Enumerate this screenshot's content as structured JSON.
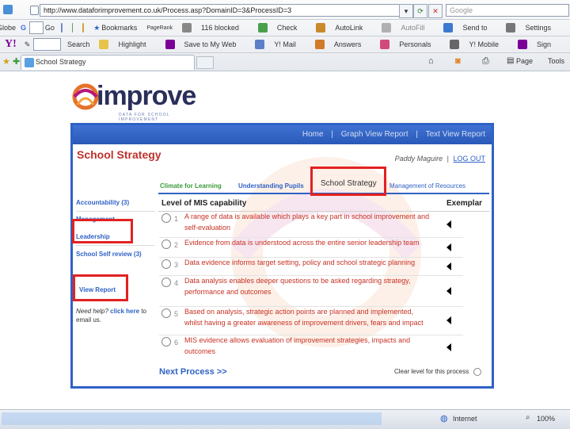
{
  "browser": {
    "address": "http://www.dataforimprovement.co.uk/Process.asp?DomainID=3&ProcessID=3",
    "search_placeholder": "Google",
    "toolbar1": {
      "brand_label": "Globe",
      "go_label": "Go",
      "bookmarks_label": "Bookmarks",
      "pagerank_label": "PageRank",
      "blocked_label": "116 blocked",
      "check_label": "Check",
      "autolink_label": "AutoLink",
      "autofill_label": "AutoFill",
      "send_label": "Send to",
      "settings_label": "Settings"
    },
    "toolbar2": {
      "search_label": "Search",
      "highlight_label": "Highlight",
      "save_label": "Save to My Web",
      "mail_label": "Y! Mail",
      "answers_label": "Answers",
      "personals_label": "Personals",
      "mobile_label": "Y! Mobile",
      "sign_label": "Sign"
    },
    "tab_title": "School Strategy",
    "page_label": "Page",
    "tools_label": "Tools",
    "status": {
      "zone_label": "Internet",
      "zoom_label": "100%"
    }
  },
  "site": {
    "logo_text": "improve",
    "logo_tagline": "DATA FOR SCHOOL IMPROVEMENT",
    "top_nav": [
      {
        "label": "Home"
      },
      {
        "label": "Graph View Report"
      },
      {
        "label": "Text View Report"
      }
    ],
    "nav_separator": "|",
    "page_heading": "School Strategy",
    "user_name": "Paddy Maguire",
    "logout_label": "LOG OUT",
    "process_tabs": [
      {
        "label": "Climate for Learning"
      },
      {
        "label": "Understanding Pupils"
      },
      {
        "label": "School Strategy"
      },
      {
        "label": "Management of Resources"
      }
    ],
    "sidebar": [
      {
        "label": "Accountability (3)"
      },
      {
        "label": "Management"
      },
      {
        "label": "Leadership"
      },
      {
        "label": "School Self review (3)"
      },
      {
        "label": "View Report"
      }
    ],
    "help_text_before": "Need help?",
    "help_link": "click here",
    "help_text_after": "to email us.",
    "table_header": "Level of MIS capability",
    "exemplar_label": "Exemplar",
    "levels": [
      {
        "num": "1",
        "line1": "A range of data is available which plays a key part in school improvement and",
        "line2": "self-evaluation"
      },
      {
        "num": "2",
        "line1": "Evidence from data is understood across the entire senior leadership team",
        "line2": ""
      },
      {
        "num": "3",
        "line1": "Data evidence informs target setting, policy and school strategic planning",
        "line2": ""
      },
      {
        "num": "4",
        "line1": "Data analysis enables deeper questions to be asked regarding strategy,",
        "line2": "performance and outcomes"
      },
      {
        "num": "5",
        "line1": "Based on analysis, strategic action points are planned and implemented,",
        "line2": "whilst having a greater awareness of improvement drivers, fears and impact"
      },
      {
        "num": "6",
        "line1": "MIS evidence allows evaluation of improvement strategies, impacts and",
        "line2": "outcomes"
      }
    ],
    "next_process_label": "Next Process >>",
    "clear_level_label": "Clear level for this process"
  },
  "colors": {
    "panel_border": "#2f62c5",
    "heading_red": "#c0312b",
    "annotation_red": "#e32121",
    "tab_green": "#3a9a3a",
    "tab_blue": "#2f62c5"
  }
}
